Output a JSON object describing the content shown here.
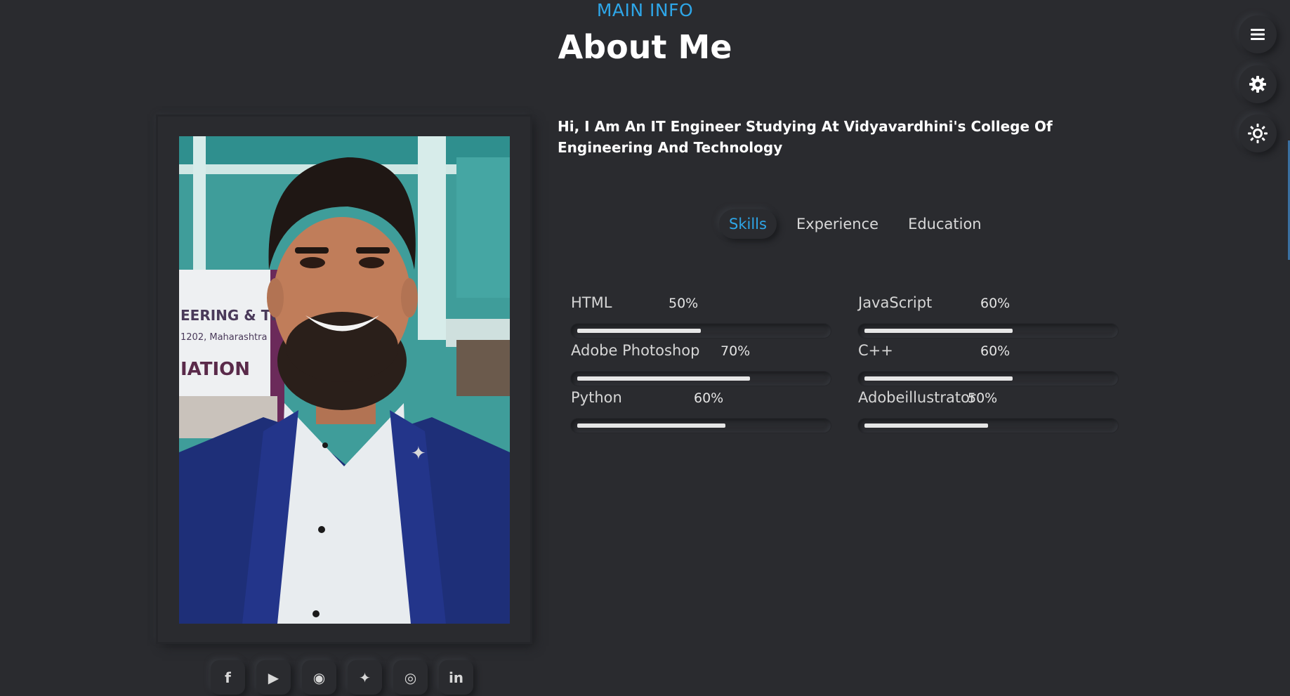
{
  "header": {
    "section_label": "MAIN INFO",
    "title": "About Me"
  },
  "intro": {
    "text": "Hi, I Am An IT Engineer Studying At Vidyavardhini's College Of Engineering And Technology"
  },
  "tabs": [
    {
      "label": "Skills",
      "active": true
    },
    {
      "label": "Experience",
      "active": false
    },
    {
      "label": "Education",
      "active": false
    }
  ],
  "skills": [
    {
      "name": "HTML",
      "percent_label": "50%",
      "level": 0.5
    },
    {
      "name": "JavaScript",
      "percent_label": "60%",
      "level": 0.6
    },
    {
      "name": "Adobe Photoshop",
      "percent_label": "70%",
      "level": 0.7
    },
    {
      "name": "C++",
      "percent_label": "60%",
      "level": 0.6
    },
    {
      "name": "Python",
      "percent_label": "60%",
      "level": 0.6
    },
    {
      "name": "Adobeillustrator",
      "percent_label": "50%",
      "level": 0.5
    }
  ],
  "social": [
    {
      "icon": "facebook-icon",
      "glyph": "f"
    },
    {
      "icon": "youtube-icon",
      "glyph": "▶"
    },
    {
      "icon": "github-icon",
      "glyph": "◉"
    },
    {
      "icon": "twitter-icon",
      "glyph": "✦"
    },
    {
      "icon": "instagram-icon",
      "glyph": "◎"
    },
    {
      "icon": "linkedin-icon",
      "glyph": "in"
    }
  ],
  "rail": [
    {
      "icon": "menu-icon"
    },
    {
      "icon": "gear-icon"
    },
    {
      "icon": "sun-icon"
    }
  ],
  "photo": {
    "sign_line1": "EERING & TEC",
    "sign_line2": "1202, Maharashtra",
    "sign_line3": "IATION"
  },
  "colors": {
    "background": "#2a2b2f",
    "accent": "#2ea6e8",
    "text": "#ffffff"
  }
}
